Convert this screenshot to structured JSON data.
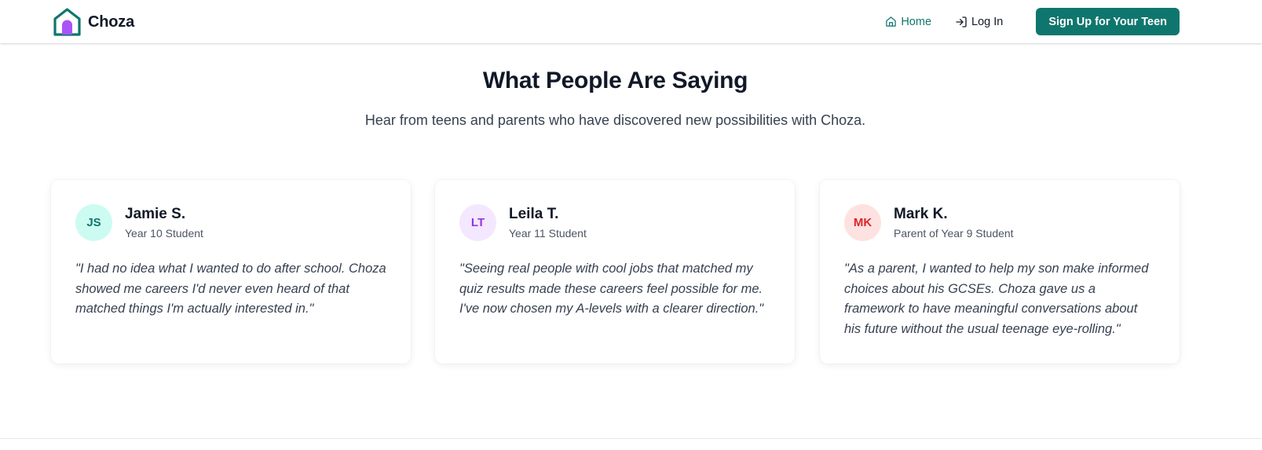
{
  "nav": {
    "brand": "Choza",
    "home_label": "Home",
    "login_label": "Log In",
    "signup_label": "Sign Up for Your Teen"
  },
  "section": {
    "title": "What People Are Saying",
    "subtitle": "Hear from teens and parents who have discovered new possibilities with Choza."
  },
  "testimonials": [
    {
      "initials": "JS",
      "name": "Jamie S.",
      "role": "Year 10 Student",
      "quote": "\"I had no idea what I wanted to do after school. Choza showed me careers I'd never even heard of that matched things I'm actually interested in.\"",
      "avatar_bg": "#ccfbf1",
      "avatar_fg": "#0f766e"
    },
    {
      "initials": "LT",
      "name": "Leila T.",
      "role": "Year 11 Student",
      "quote": "\"Seeing real people with cool jobs that matched my quiz results made these careers feel possible for me. I've now chosen my A-levels with a clearer direction.\"",
      "avatar_bg": "#f3e8ff",
      "avatar_fg": "#9333ea"
    },
    {
      "initials": "MK",
      "name": "Mark K.",
      "role": "Parent of Year 9 Student",
      "quote": "\"As a parent, I wanted to help my son make informed choices about his GCSEs. Choza gave us a framework to have meaningful conversations about his future without the usual teenage eye-rolling.\"",
      "avatar_bg": "#fee2e2",
      "avatar_fg": "#dc2626"
    }
  ],
  "colors": {
    "brand_teal": "#0f766e",
    "logo_purple": "#a855f7"
  }
}
